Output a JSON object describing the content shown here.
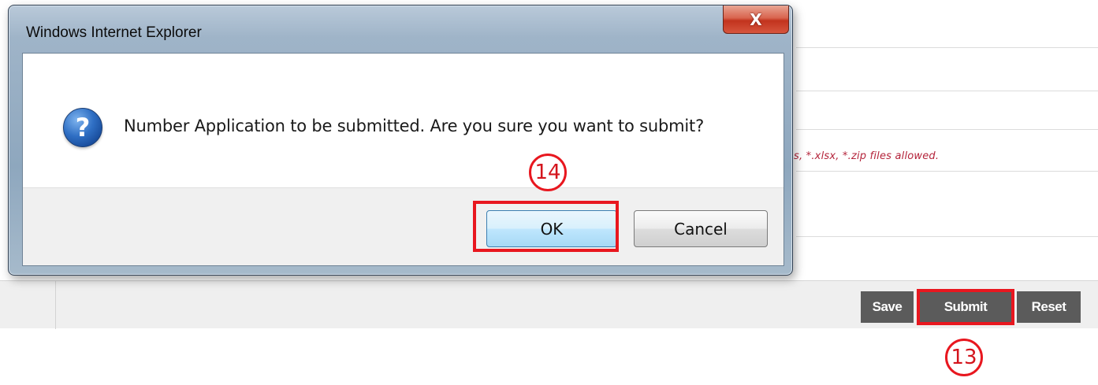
{
  "dialog": {
    "title": "Windows Internet Explorer",
    "close_glyph": "X",
    "message": "Number Application to be submitted. Are you sure you want to submit?",
    "icon": "question-icon",
    "ok_label": "OK",
    "cancel_label": "Cancel"
  },
  "background_page": {
    "file_hint": "s, *.xlsx, *.zip files allowed.",
    "actions": {
      "save_label": "Save",
      "submit_label": "Submit",
      "reset_label": "Reset"
    }
  },
  "annotations": {
    "step_ok": "14",
    "step_submit": "13",
    "highlight_color": "#e8171f"
  }
}
